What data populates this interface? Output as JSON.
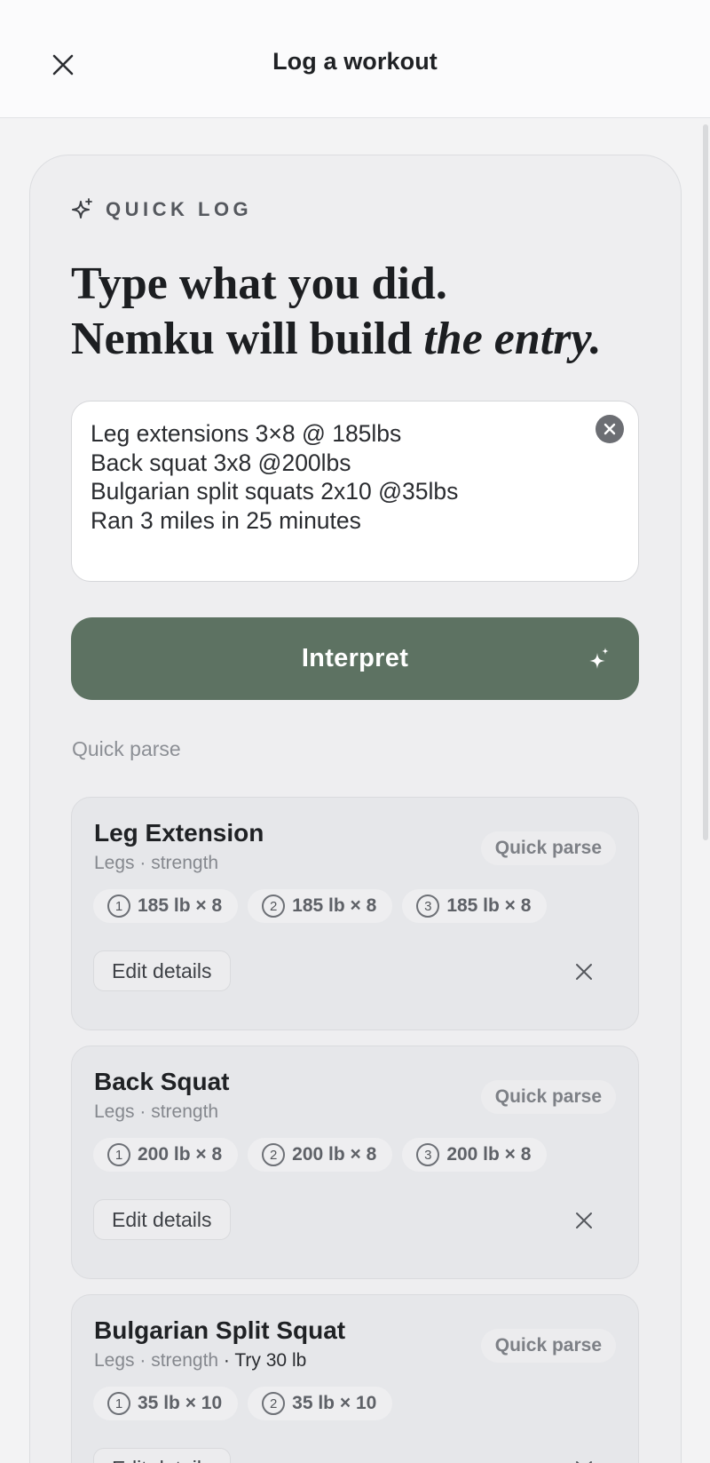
{
  "header": {
    "title": "Log a workout",
    "close_icon": "close-icon"
  },
  "quick_log": {
    "eyebrow": "QUICK LOG",
    "headline_line1": "Type what you did.",
    "headline_line2_prefix": "Nemku will build ",
    "headline_line2_emphasis": "the entry.",
    "input_value": "Leg extensions 3×8 @ 185lbs\nBack squat 3x8 @200lbs\nBulgarian split squats 2x10 @35lbs\nRan 3 miles in 25 minutes",
    "interpret_label": "Interpret",
    "section_label": "Quick parse",
    "accent_color": "#5d7262"
  },
  "exercises": [
    {
      "name": "Leg Extension",
      "meta": "Legs · strength",
      "tip": "",
      "badge": "Quick parse",
      "sets": [
        {
          "num": "1",
          "label": "185 lb × 8"
        },
        {
          "num": "2",
          "label": "185 lb × 8"
        },
        {
          "num": "3",
          "label": "185 lb × 8"
        }
      ],
      "edit_label": "Edit details"
    },
    {
      "name": "Back Squat",
      "meta": "Legs · strength",
      "tip": "",
      "badge": "Quick parse",
      "sets": [
        {
          "num": "1",
          "label": "200 lb × 8"
        },
        {
          "num": "2",
          "label": "200 lb × 8"
        },
        {
          "num": "3",
          "label": "200 lb × 8"
        }
      ],
      "edit_label": "Edit details"
    },
    {
      "name": "Bulgarian Split Squat",
      "meta": "Legs · strength",
      "tip": " · Try 30 lb",
      "badge": "Quick parse",
      "sets": [
        {
          "num": "1",
          "label": "35 lb × 10"
        },
        {
          "num": "2",
          "label": "35 lb × 10"
        }
      ],
      "edit_label": "Edit details"
    }
  ]
}
